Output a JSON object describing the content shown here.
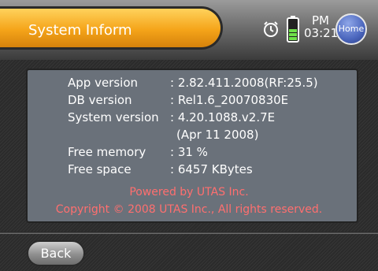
{
  "header": {
    "title": "System Inform",
    "time_ampm": "PM",
    "time": "03:21",
    "home_label": "Home"
  },
  "info": {
    "rows": [
      {
        "label": "App version",
        "value": ": 2.82.411.2008(RF:25.5)"
      },
      {
        "label": "DB version",
        "value": ": Rel1.6_20070830E"
      },
      {
        "label": "System version",
        "value": ": 4.20.1088.v2.7E"
      },
      {
        "label": "",
        "value": "(Apr 11 2008)"
      },
      {
        "label": "Free memory",
        "value": ": 31 %"
      },
      {
        "label": "Free space",
        "value": ": 6457 KBytes"
      }
    ],
    "powered": "Powered by UTAS Inc.",
    "copyright": "Copyright © 2008 UTAS Inc., All rights reserved."
  },
  "footer": {
    "back_label": "Back"
  },
  "colors": {
    "accent_orange": "#f5a419",
    "text_red": "#ff6f6f",
    "home_blue": "#4b66bd",
    "battery_green": "#6fe04a"
  },
  "icons": [
    "alarm-clock-icon",
    "battery-icon"
  ]
}
